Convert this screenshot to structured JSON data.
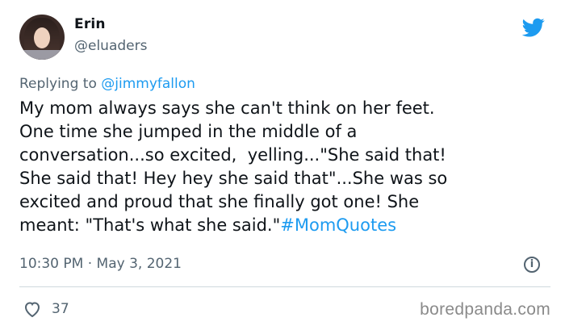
{
  "user": {
    "name": "Erin",
    "handle": "@eluaders"
  },
  "reply": {
    "prefix": "Replying to ",
    "mention": "@jimmyfallon"
  },
  "tweet": {
    "lines": [
      "My mom always says she can't think on her feet.",
      "One time she jumped in the middle of a",
      "conversation...so excited,  yelling...\"She said that!",
      "She said that! Hey hey she said that\"...She was so",
      "excited and proud that she finally got one! She",
      "meant: \"That's what she said.\""
    ],
    "hashtag": "#MomQuotes"
  },
  "meta": {
    "timestamp": "10:30 PM · May 3, 2021"
  },
  "actions": {
    "like_count": "37"
  },
  "watermark": "boredpanda.com",
  "icons": {
    "brand": "twitter-bird-icon",
    "like": "heart-icon",
    "info": "info-icon"
  },
  "colors": {
    "accent": "#1d9bf0",
    "muted": "#536471",
    "text": "#0f1419",
    "divider": "#cfd9de"
  }
}
